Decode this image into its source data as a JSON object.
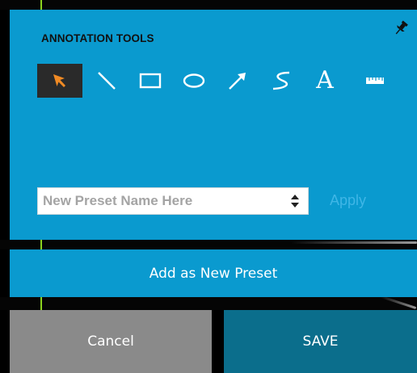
{
  "panel": {
    "title": "ANNOTATION TOOLS",
    "pin_icon": "pin-icon",
    "tools": [
      {
        "name": "select",
        "icon": "arrow-pointer-icon",
        "selected": true
      },
      {
        "name": "line",
        "icon": "line-icon",
        "selected": false
      },
      {
        "name": "rectangle",
        "icon": "rectangle-icon",
        "selected": false
      },
      {
        "name": "ellipse",
        "icon": "ellipse-icon",
        "selected": false
      },
      {
        "name": "arrow",
        "icon": "arrow-icon",
        "selected": false
      },
      {
        "name": "freehand",
        "icon": "freehand-icon",
        "selected": false
      },
      {
        "name": "text",
        "icon": "text-icon",
        "label": "A",
        "selected": false
      },
      {
        "name": "ruler",
        "icon": "ruler-icon",
        "selected": false
      }
    ]
  },
  "preset": {
    "placeholder": "New Preset Name Here",
    "apply_label": "Apply"
  },
  "actions": {
    "add_preset_label": "Add as New Preset",
    "cancel_label": "Cancel",
    "save_label": "SAVE"
  },
  "colors": {
    "panel": "#0a9acf",
    "selected_tool_bg": "#2a2a2a",
    "selected_tool_icon": "#f08a24",
    "cancel": "#8a8a8a",
    "save": "#0b6e8c",
    "apply_disabled": "#3fb6e6"
  }
}
